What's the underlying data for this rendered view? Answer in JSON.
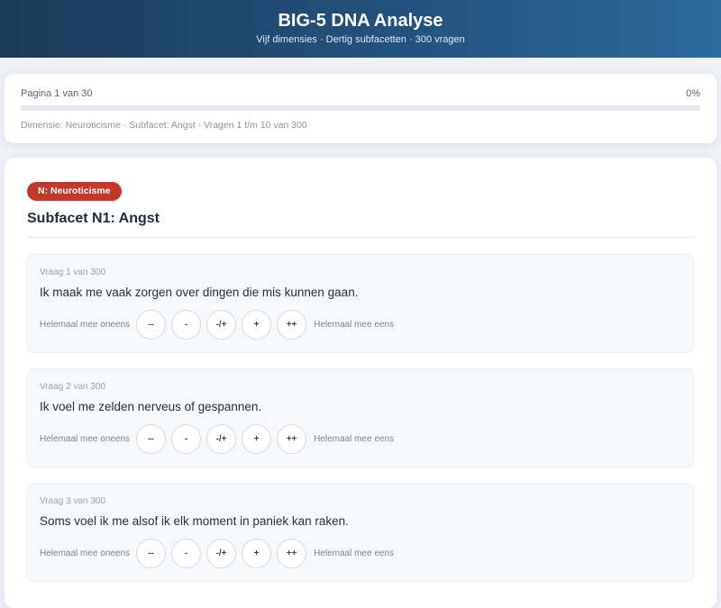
{
  "header": {
    "title": "BIG-5 DNA Analyse",
    "subtitle": "Vijf dimensies · Dertig subfacetten · 300 vragen"
  },
  "progress": {
    "page_label": "Pagina 1 van 30",
    "percent_label": "0%",
    "percent": 0,
    "info": "Dimensie: Neuroticisme · Subfacet: Angst · Vragen 1 t/m 10 van 300"
  },
  "section": {
    "badge": "N: Neuroticisme",
    "badge_color": "#c0392b",
    "title": "Subfacet N1: Angst"
  },
  "scale": {
    "left_label": "Helemaal mee oneens",
    "right_label": "Helemaal mee eens",
    "options": [
      "--",
      "-",
      "-/+",
      "+",
      "++"
    ]
  },
  "questions": [
    {
      "number": "Vraag 1 van 300",
      "text": "Ik maak me vaak zorgen over dingen die mis kunnen gaan."
    },
    {
      "number": "Vraag 2 van 300",
      "text": "Ik voel me zelden nerveus of gespannen."
    },
    {
      "number": "Vraag 3 van 300",
      "text": "Soms voel ik me alsof ik elk moment in paniek kan raken."
    }
  ],
  "colors": {
    "header_start": "#1c3a59",
    "header_end": "#2a6a9c",
    "accent": "#2a6a9c"
  }
}
